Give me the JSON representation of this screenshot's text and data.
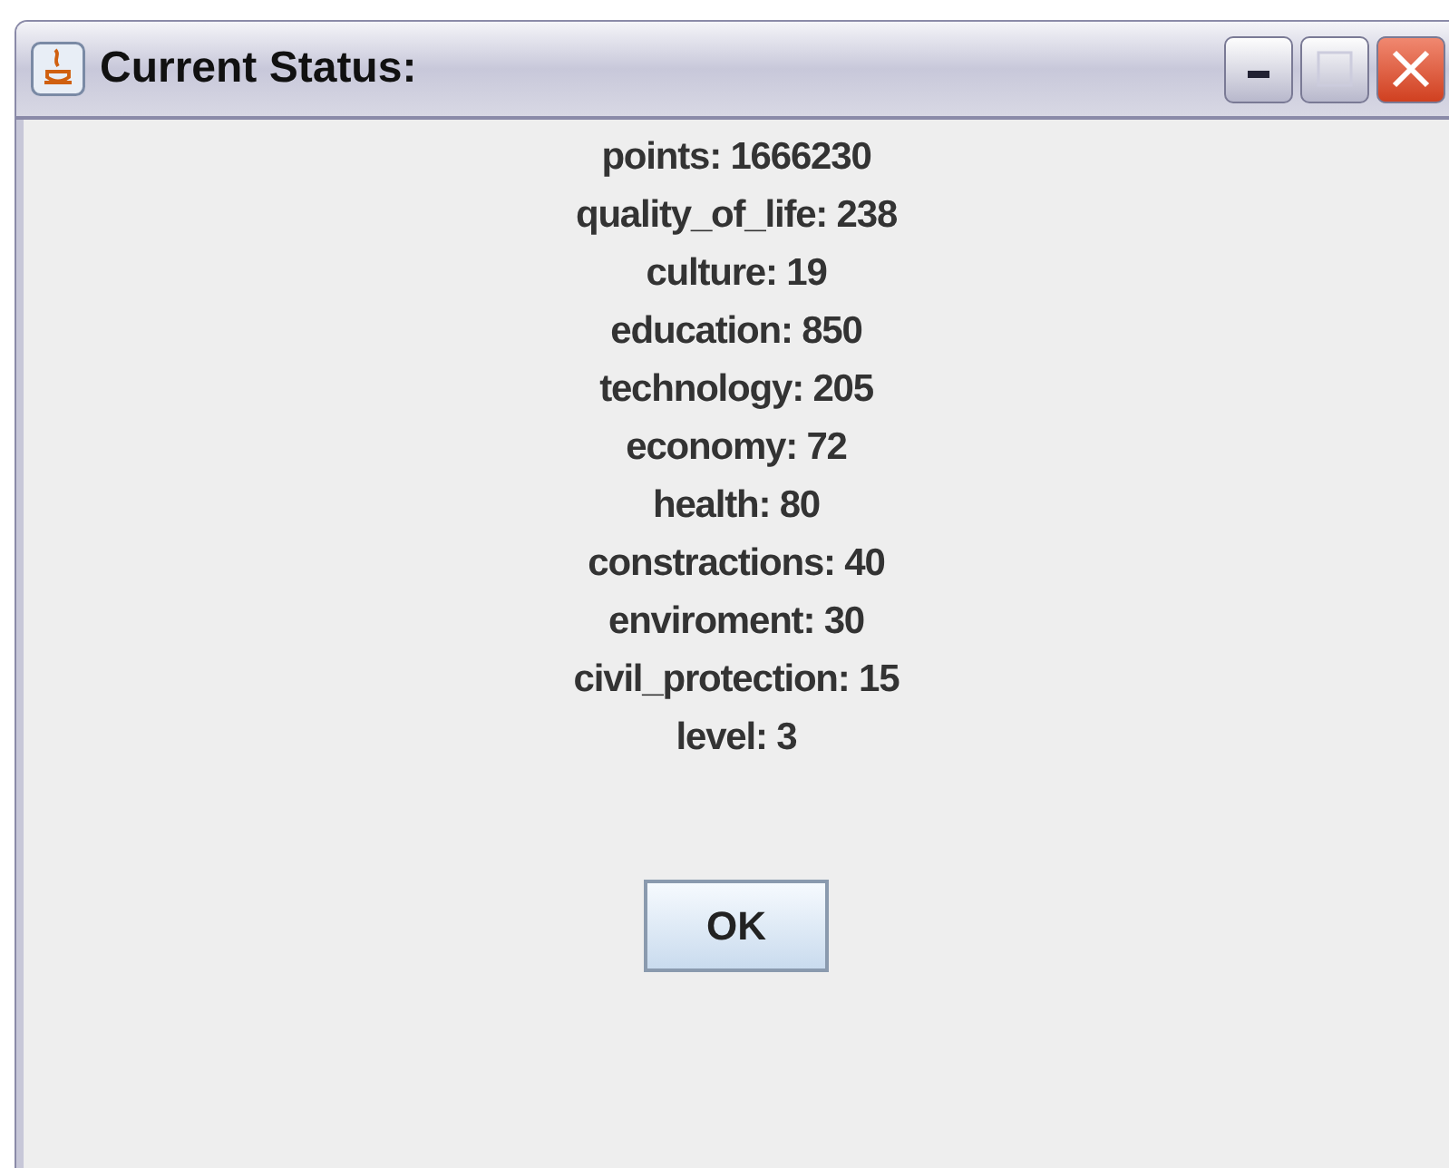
{
  "window": {
    "title": "Current Status:"
  },
  "lines": [
    "points: 1666230",
    "quality_of_life: 238",
    "culture: 19",
    "education: 850",
    "technology: 205",
    "economy: 72",
    "health: 80",
    "constractions: 40",
    "enviroment: 30",
    "civil_protection: 15",
    "level: 3"
  ],
  "buttons": [
    "OK"
  ]
}
